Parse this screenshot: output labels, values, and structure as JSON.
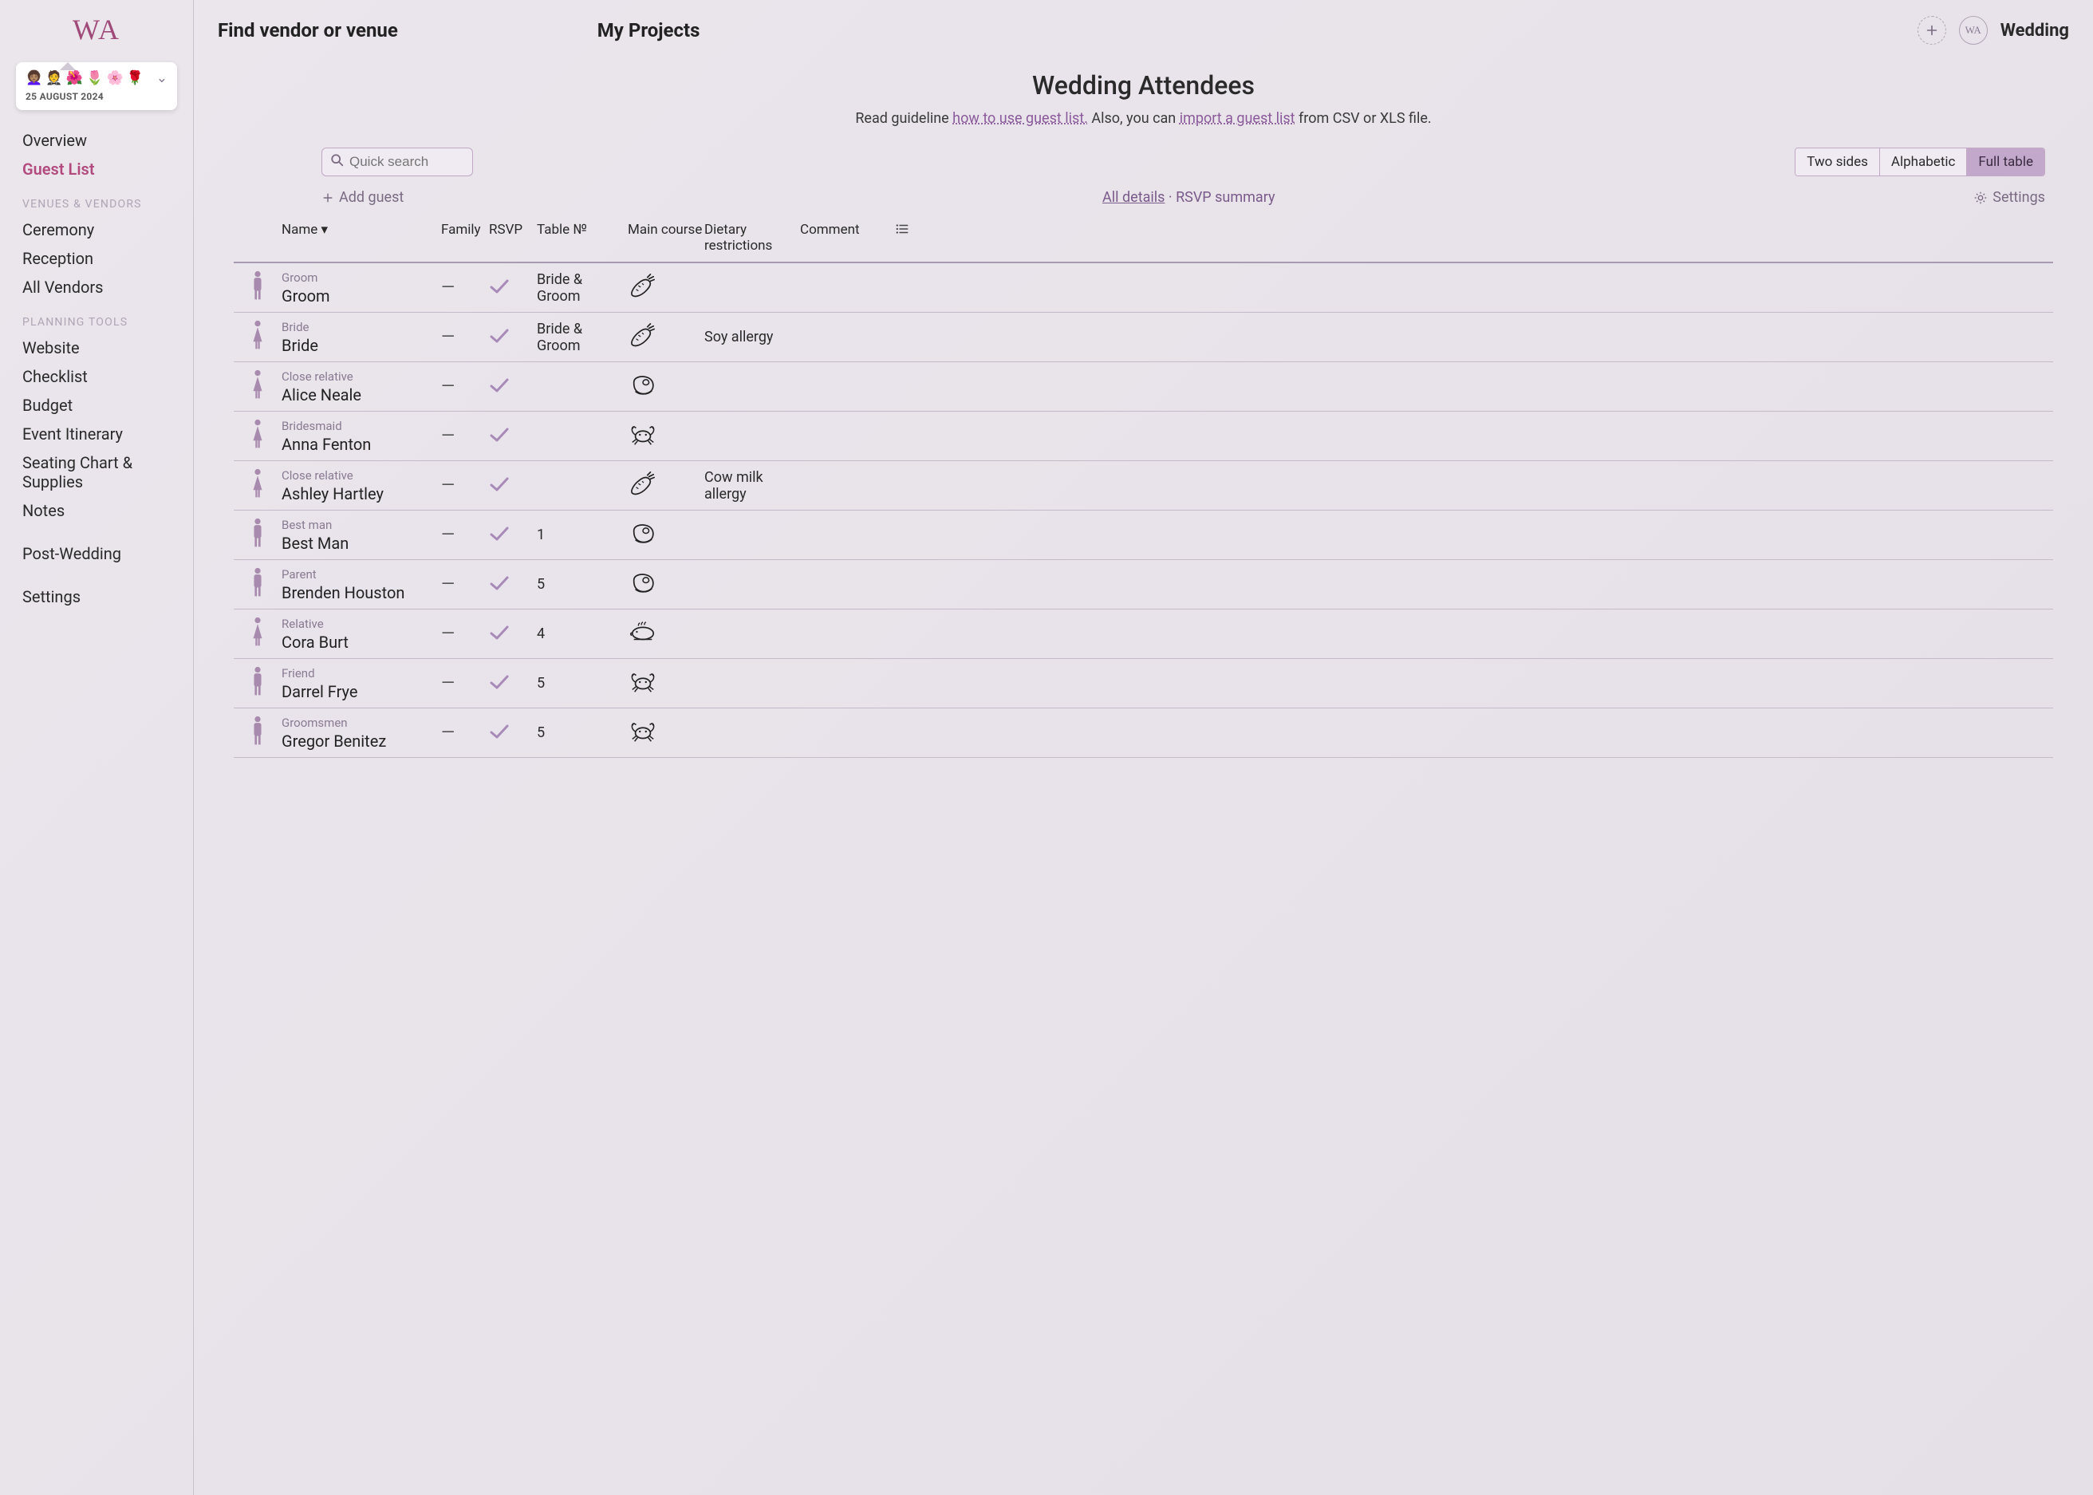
{
  "logo": "WA",
  "project": {
    "emojis": "👩🏽‍🦱 🤵 🌺 🌷 🌸 🌹",
    "date": "25 AUGUST 2024"
  },
  "sidebar": {
    "items": [
      {
        "label": "Overview",
        "active": false
      },
      {
        "label": "Guest List",
        "active": true
      }
    ],
    "section_venues": "VENUES & VENDORS",
    "venues_items": [
      "Ceremony",
      "Reception",
      "All Vendors"
    ],
    "section_planning": "PLANNING TOOLS",
    "planning_items": [
      "Website",
      "Checklist",
      "Budget",
      "Event Itinerary",
      "Seating Chart & Supplies",
      "Notes"
    ],
    "post_wedding": "Post-Wedding",
    "settings": "Settings"
  },
  "topbar": {
    "find": "Find vendor or venue",
    "my_projects": "My Projects",
    "user": "Wedding",
    "avatar": "WA"
  },
  "page": {
    "title": "Wedding Attendees",
    "help_pre": "Read guideline ",
    "help_link1": "how to use guest list.",
    "help_mid": " Also, you can ",
    "help_link2": "import a guest list",
    "help_post": " from CSV or XLS file."
  },
  "search": {
    "placeholder": "Quick search"
  },
  "view_tabs": [
    "Two sides",
    "Alphabetic",
    "Full table"
  ],
  "active_view_tab": 2,
  "add_guest": "Add guest",
  "detail_links": {
    "all": "All details",
    "summary": "RSVP summary"
  },
  "settings_link": "Settings",
  "columns": {
    "name": "Name",
    "family": "Family",
    "rsvp": "RSVP",
    "table": "Table №",
    "main": "Main course",
    "diet": "Dietary restrictions",
    "comment": "Comment"
  },
  "guests": [
    {
      "role": "Groom",
      "name": "Groom",
      "gender": "m",
      "family": "—",
      "rsvp": true,
      "table": "Bride & Groom",
      "meal": "carrot",
      "diet": "",
      "comment": ""
    },
    {
      "role": "Bride",
      "name": "Bride",
      "gender": "f",
      "family": "—",
      "rsvp": true,
      "table": "Bride & Groom",
      "meal": "carrot",
      "diet": "Soy allergy",
      "comment": ""
    },
    {
      "role": "Close relative",
      "name": "Alice Neale",
      "gender": "f",
      "family": "—",
      "rsvp": true,
      "table": "",
      "meal": "steak",
      "diet": "",
      "comment": ""
    },
    {
      "role": "Bridesmaid",
      "name": "Anna Fenton",
      "gender": "f",
      "family": "—",
      "rsvp": true,
      "table": "",
      "meal": "crab",
      "diet": "",
      "comment": ""
    },
    {
      "role": "Close relative",
      "name": "Ashley Hartley",
      "gender": "f",
      "family": "—",
      "rsvp": true,
      "table": "",
      "meal": "carrot",
      "diet": "Cow milk allergy",
      "comment": ""
    },
    {
      "role": "Best man",
      "name": "Best Man",
      "gender": "m",
      "family": "—",
      "rsvp": true,
      "table": "1",
      "meal": "steak",
      "diet": "",
      "comment": ""
    },
    {
      "role": "Parent",
      "name": "Brenden Houston",
      "gender": "m",
      "family": "—",
      "rsvp": true,
      "table": "5",
      "meal": "steak",
      "diet": "",
      "comment": ""
    },
    {
      "role": "Relative",
      "name": "Cora Burt",
      "gender": "f",
      "family": "—",
      "rsvp": true,
      "table": "4",
      "meal": "fish",
      "diet": "",
      "comment": ""
    },
    {
      "role": "Friend",
      "name": "Darrel Frye",
      "gender": "m",
      "family": "—",
      "rsvp": true,
      "table": "5",
      "meal": "crab",
      "diet": "",
      "comment": ""
    },
    {
      "role": "Groomsmen",
      "name": "Gregor Benitez",
      "gender": "m",
      "family": "—",
      "rsvp": true,
      "table": "5",
      "meal": "crab",
      "diet": "",
      "comment": ""
    }
  ]
}
